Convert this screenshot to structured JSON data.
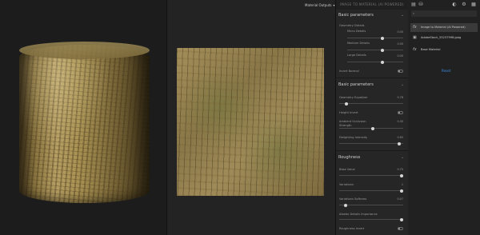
{
  "header": {
    "outputs_label": "Material Outputs"
  },
  "panel": {
    "title": "IMAGE TO MATERIAL (AI POWERED)",
    "section1": {
      "title": "Basic parameters",
      "geometry_details_label": "Geometry Details",
      "sliders": [
        {
          "label": "Micro Details",
          "value": "0.00",
          "pos": 0.63
        },
        {
          "label": "Medium Details",
          "value": "0.00",
          "pos": 0.63
        },
        {
          "label": "Large Details",
          "value": "0.00",
          "pos": 0.63
        }
      ],
      "invert_normal": "Invert Normal"
    },
    "section2": {
      "title": "Basic parameters",
      "geometry_equalizer": {
        "label": "Geometry Equalizer",
        "value": "0.78",
        "pos": 0.11
      },
      "height_invert": "Height Invert",
      "ao_strength": {
        "label1": "Ambient Occlusion",
        "label2": "Strength",
        "value": "0.30",
        "pos": 0.53
      },
      "delighting": {
        "label": "Delighting Intensity",
        "value": "0.65",
        "pos": 0.94
      }
    },
    "section3": {
      "title": "Roughness",
      "base_value": {
        "label": "Base Value",
        "value": "0.70",
        "pos": 0.98
      },
      "variations": {
        "label": "Variations",
        "value": "1",
        "pos": 0.98
      },
      "variations_softness": {
        "label": "Variations Softness",
        "value": "0.07",
        "pos": 0.1
      },
      "albedo_details": {
        "label": "Albedo Details Importance",
        "value": "",
        "pos": 0.98
      },
      "roughness_invert": "Roughness Invert"
    }
  },
  "layers": {
    "search_placeholder": "Search",
    "items": [
      {
        "label": "Image to Material (AI Powered)",
        "active": true
      },
      {
        "label": "AdobeStock_55237998.jpeg",
        "active": false
      },
      {
        "label": "Base Material",
        "active": false
      }
    ],
    "reset_label": "Reset"
  }
}
